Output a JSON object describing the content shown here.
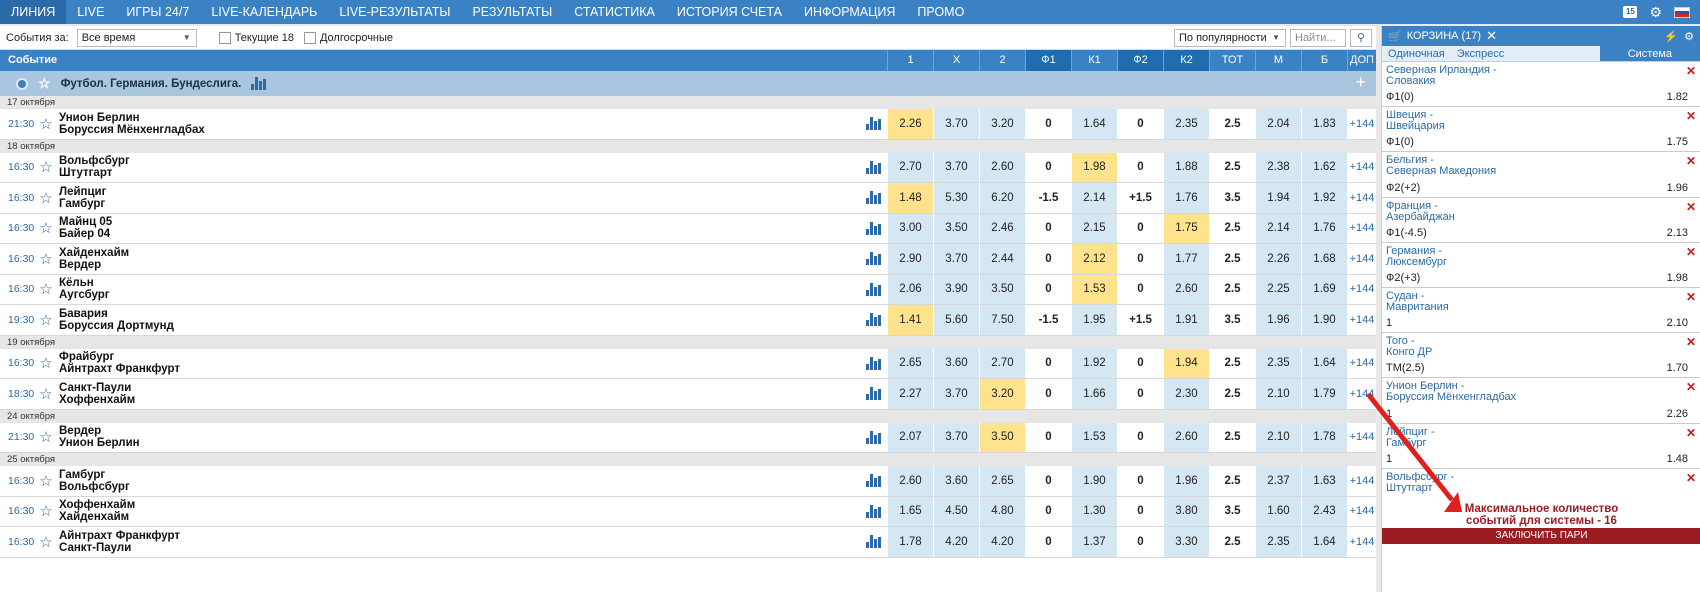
{
  "nav": {
    "items": [
      "ЛИНИЯ",
      "LIVE",
      "ИГРЫ 24/7",
      "LIVE-КАЛЕНДАРЬ",
      "LIVE-РЕЗУЛЬТАТЫ",
      "РЕЗУЛЬТАТЫ",
      "СТАТИСТИКА",
      "ИСТОРИЯ СЧЕТА",
      "ИНФОРМАЦИЯ",
      "ПРОМО"
    ],
    "badge": "15"
  },
  "filters": {
    "events_label": "События за:",
    "period": "Все время",
    "current_label": "Текущие 18",
    "longterm_label": "Долгосрочные",
    "sort": "По популярности",
    "search_placeholder": "Найти..."
  },
  "header": {
    "event": "Событие",
    "cols": [
      "1",
      "X",
      "2",
      "Ф1",
      "К1",
      "Ф2",
      "К2",
      "ТОТ",
      "М",
      "Б",
      "ДОП"
    ]
  },
  "league": "Футбол. Германия. Бундеслига.",
  "groups": [
    {
      "date": "17 октября",
      "matches": [
        {
          "time": "21:30",
          "home": "Унион Берлин",
          "away": "Боруссия Мёнхенгладбах",
          "odds": [
            "2.26",
            "3.70",
            "3.20",
            "0",
            "1.64",
            "0",
            "2.35",
            "2.5",
            "2.04",
            "1.83"
          ],
          "dop": "+144",
          "hl": [
            0
          ]
        }
      ]
    },
    {
      "date": "18 октября",
      "matches": [
        {
          "time": "16:30",
          "home": "Вольфсбург",
          "away": "Штутгарт",
          "odds": [
            "2.70",
            "3.70",
            "2.60",
            "0",
            "1.98",
            "0",
            "1.88",
            "2.5",
            "2.38",
            "1.62"
          ],
          "dop": "+144",
          "hl": [
            4
          ]
        },
        {
          "time": "16:30",
          "home": "Лейпциг",
          "away": "Гамбург",
          "odds": [
            "1.48",
            "5.30",
            "6.20",
            "-1.5",
            "2.14",
            "+1.5",
            "1.76",
            "3.5",
            "1.94",
            "1.92"
          ],
          "dop": "+144",
          "hl": [
            0
          ]
        },
        {
          "time": "16:30",
          "home": "Майнц 05",
          "away": "Байер 04",
          "odds": [
            "3.00",
            "3.50",
            "2.46",
            "0",
            "2.15",
            "0",
            "1.75",
            "2.5",
            "2.14",
            "1.76"
          ],
          "dop": "+144",
          "hl": [
            6
          ]
        },
        {
          "time": "16:30",
          "home": "Хайденхайм",
          "away": "Вердер",
          "odds": [
            "2.90",
            "3.70",
            "2.44",
            "0",
            "2.12",
            "0",
            "1.77",
            "2.5",
            "2.26",
            "1.68"
          ],
          "dop": "+144",
          "hl": [
            4
          ]
        },
        {
          "time": "16:30",
          "home": "Кёльн",
          "away": "Аугсбург",
          "odds": [
            "2.06",
            "3.90",
            "3.50",
            "0",
            "1.53",
            "0",
            "2.60",
            "2.5",
            "2.25",
            "1.69"
          ],
          "dop": "+144",
          "hl": [
            4
          ]
        },
        {
          "time": "19:30",
          "home": "Бавария",
          "away": "Боруссия Дортмунд",
          "odds": [
            "1.41",
            "5.60",
            "7.50",
            "-1.5",
            "1.95",
            "+1.5",
            "1.91",
            "3.5",
            "1.96",
            "1.90"
          ],
          "dop": "+144",
          "hl": [
            0
          ]
        }
      ]
    },
    {
      "date": "19 октября",
      "matches": [
        {
          "time": "16:30",
          "home": "Фрайбург",
          "away": "Айнтрахт Франкфурт",
          "odds": [
            "2.65",
            "3.60",
            "2.70",
            "0",
            "1.92",
            "0",
            "1.94",
            "2.5",
            "2.35",
            "1.64"
          ],
          "dop": "+144",
          "hl": [
            6
          ]
        },
        {
          "time": "18:30",
          "home": "Санкт-Паули",
          "away": "Хоффенхайм",
          "odds": [
            "2.27",
            "3.70",
            "3.20",
            "0",
            "1.66",
            "0",
            "2.30",
            "2.5",
            "2.10",
            "1.79"
          ],
          "dop": "+144",
          "hl": [
            2
          ]
        }
      ]
    },
    {
      "date": "24 октября",
      "matches": [
        {
          "time": "21:30",
          "home": "Вердер",
          "away": "Унион Берлин",
          "odds": [
            "2.07",
            "3.70",
            "3.50",
            "0",
            "1.53",
            "0",
            "2.60",
            "2.5",
            "2.10",
            "1.78"
          ],
          "dop": "+144",
          "hl": [
            2
          ]
        }
      ]
    },
    {
      "date": "25 октября",
      "matches": [
        {
          "time": "16:30",
          "home": "Гамбург",
          "away": "Вольфсбург",
          "odds": [
            "2.60",
            "3.60",
            "2.65",
            "0",
            "1.90",
            "0",
            "1.96",
            "2.5",
            "2.37",
            "1.63"
          ],
          "dop": "+144",
          "hl": []
        },
        {
          "time": "16:30",
          "home": "Хоффенхайм",
          "away": "Хайденхайм",
          "odds": [
            "1.65",
            "4.50",
            "4.80",
            "0",
            "1.30",
            "0",
            "3.80",
            "3.5",
            "1.60",
            "2.43"
          ],
          "dop": "+144",
          "hl": []
        },
        {
          "time": "16:30",
          "home": "Айнтрахт Франкфурт",
          "away": "Санкт-Паули",
          "odds": [
            "1.78",
            "4.20",
            "4.20",
            "0",
            "1.37",
            "0",
            "3.30",
            "2.5",
            "2.35",
            "1.64"
          ],
          "dop": "+144",
          "hl": []
        }
      ]
    }
  ],
  "cart": {
    "title": "КОРЗИНА (17)",
    "tabs": [
      "Одиночная",
      "Экспресс",
      "Система"
    ],
    "bets": [
      {
        "t1": "Северная Ирландия -",
        "t2": "Словакия",
        "out": "Ф1(0)",
        "val": "1.82"
      },
      {
        "t1": "Швеция -",
        "t2": "Швейцария",
        "out": "Ф1(0)",
        "val": "1.75"
      },
      {
        "t1": "Бельгия -",
        "t2": "Северная Македония",
        "out": "Ф2(+2)",
        "val": "1.96"
      },
      {
        "t1": "Франция -",
        "t2": "Азербайджан",
        "out": "Ф1(-4.5)",
        "val": "2.13"
      },
      {
        "t1": "Германия -",
        "t2": "Люксембург",
        "out": "Ф2(+3)",
        "val": "1.98"
      },
      {
        "t1": "Судан -",
        "t2": "Мавритания",
        "out": "1",
        "val": "2.10"
      },
      {
        "t1": "Того -",
        "t2": "Конго ДР",
        "out": "ТМ(2.5)",
        "val": "1.70"
      },
      {
        "t1": "Унион Берлин -",
        "t2": "Боруссия Мёнхенгладбах",
        "out": "1",
        "val": "2.26"
      },
      {
        "t1": "Лейпциг -",
        "t2": "Гамбург",
        "out": "1",
        "val": "1.48"
      },
      {
        "t1": "Вольфсбург -",
        "t2": "Штутгарт",
        "out": "",
        "val": ""
      }
    ],
    "max_msg_1": "Максимальное количество",
    "max_msg_2": "событий для системы - 16",
    "place_label": "ЗАКЛЮЧИТЬ ПАРИ"
  },
  "colors": {
    "nav": "#3b82c4",
    "highlight": "#ffe38c",
    "odds_bg": "#d5e7f3",
    "alert": "#9b1d22",
    "arrow": "#e0201c"
  }
}
